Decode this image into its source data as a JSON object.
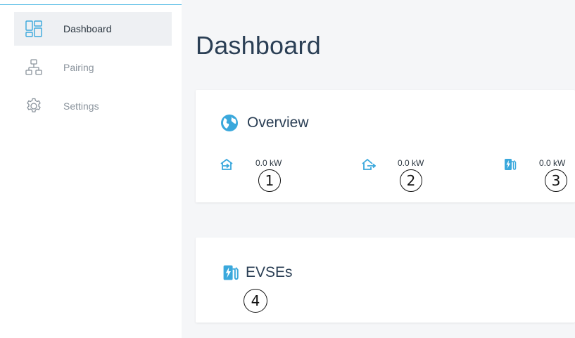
{
  "sidebar": {
    "items": [
      {
        "label": "Dashboard",
        "icon": "dashboard-icon",
        "active": true
      },
      {
        "label": "Pairing",
        "icon": "pairing-icon",
        "active": false
      },
      {
        "label": "Settings",
        "icon": "gear-icon",
        "active": false
      }
    ]
  },
  "main": {
    "title": "Dashboard",
    "overview": {
      "title": "Overview",
      "icon": "globe-icon",
      "metrics": [
        {
          "icon": "house-import-icon",
          "value": "0.0 kW",
          "badge": "1"
        },
        {
          "icon": "house-export-icon",
          "value": "0.0 kW",
          "badge": "2"
        },
        {
          "icon": "charger-icon",
          "value": "0.0 kW",
          "badge": "3"
        }
      ]
    },
    "evses": {
      "title": "EVSEs",
      "icon": "charger-icon",
      "badge": "4"
    }
  },
  "colors": {
    "accent": "#3aa8dc",
    "sidebar_line": "#6ec6e9",
    "title_text": "#2b3f55",
    "muted_text": "#8a939c",
    "active_bg": "#eef0f3",
    "page_bg": "#f5f6f8"
  }
}
